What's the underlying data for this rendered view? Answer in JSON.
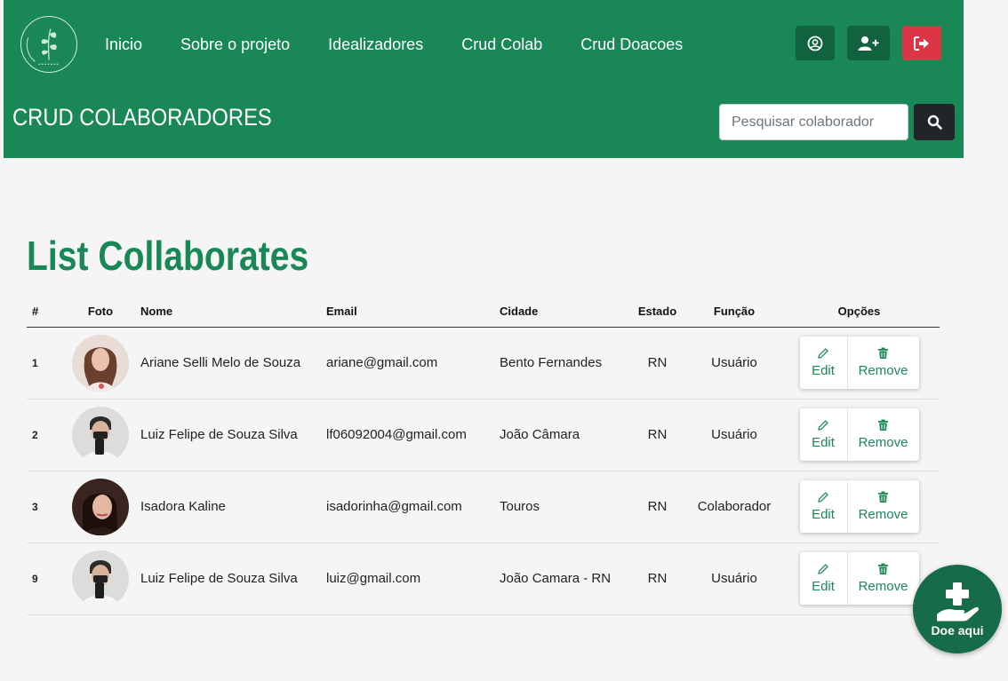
{
  "nav": {
    "items": [
      "Inicio",
      "Sobre o projeto",
      "Idealizadores",
      "Crud Colab",
      "Crud Doacoes"
    ]
  },
  "header": {
    "title": "CRUD COLABORADORES",
    "search_placeholder": "Pesquisar colaborador"
  },
  "main": {
    "title": "List Collaborates",
    "columns": [
      "#",
      "Foto",
      "Nome",
      "Email",
      "Cidade",
      "Estado",
      "Função",
      "Opções"
    ],
    "rows": [
      {
        "id": "1",
        "nome": "Ariane Selli Melo de Souza",
        "email": "ariane@gmail.com",
        "cidade": "Bento Fernandes",
        "estado": "RN",
        "funcao": "Usuário"
      },
      {
        "id": "2",
        "nome": "Luiz Felipe de Souza Silva",
        "email": "lf06092004@gmail.com",
        "cidade": "João Câmara",
        "estado": "RN",
        "funcao": "Usuário"
      },
      {
        "id": "3",
        "nome": "Isadora Kaline",
        "email": "isadorinha@gmail.com",
        "cidade": "Touros",
        "estado": "RN",
        "funcao": "Colaborador"
      },
      {
        "id": "9",
        "nome": "Luiz Felipe de Souza Silva",
        "email": "luiz@gmail.com",
        "cidade": "João Camara - RN",
        "estado": "RN",
        "funcao": "Usuário"
      }
    ],
    "edit_label": "Edit",
    "remove_label": "Remove"
  },
  "fab": {
    "label": "Doe aqui"
  },
  "colors": {
    "brand": "#1a8856",
    "danger": "#dc3545",
    "dark": "#212529"
  }
}
